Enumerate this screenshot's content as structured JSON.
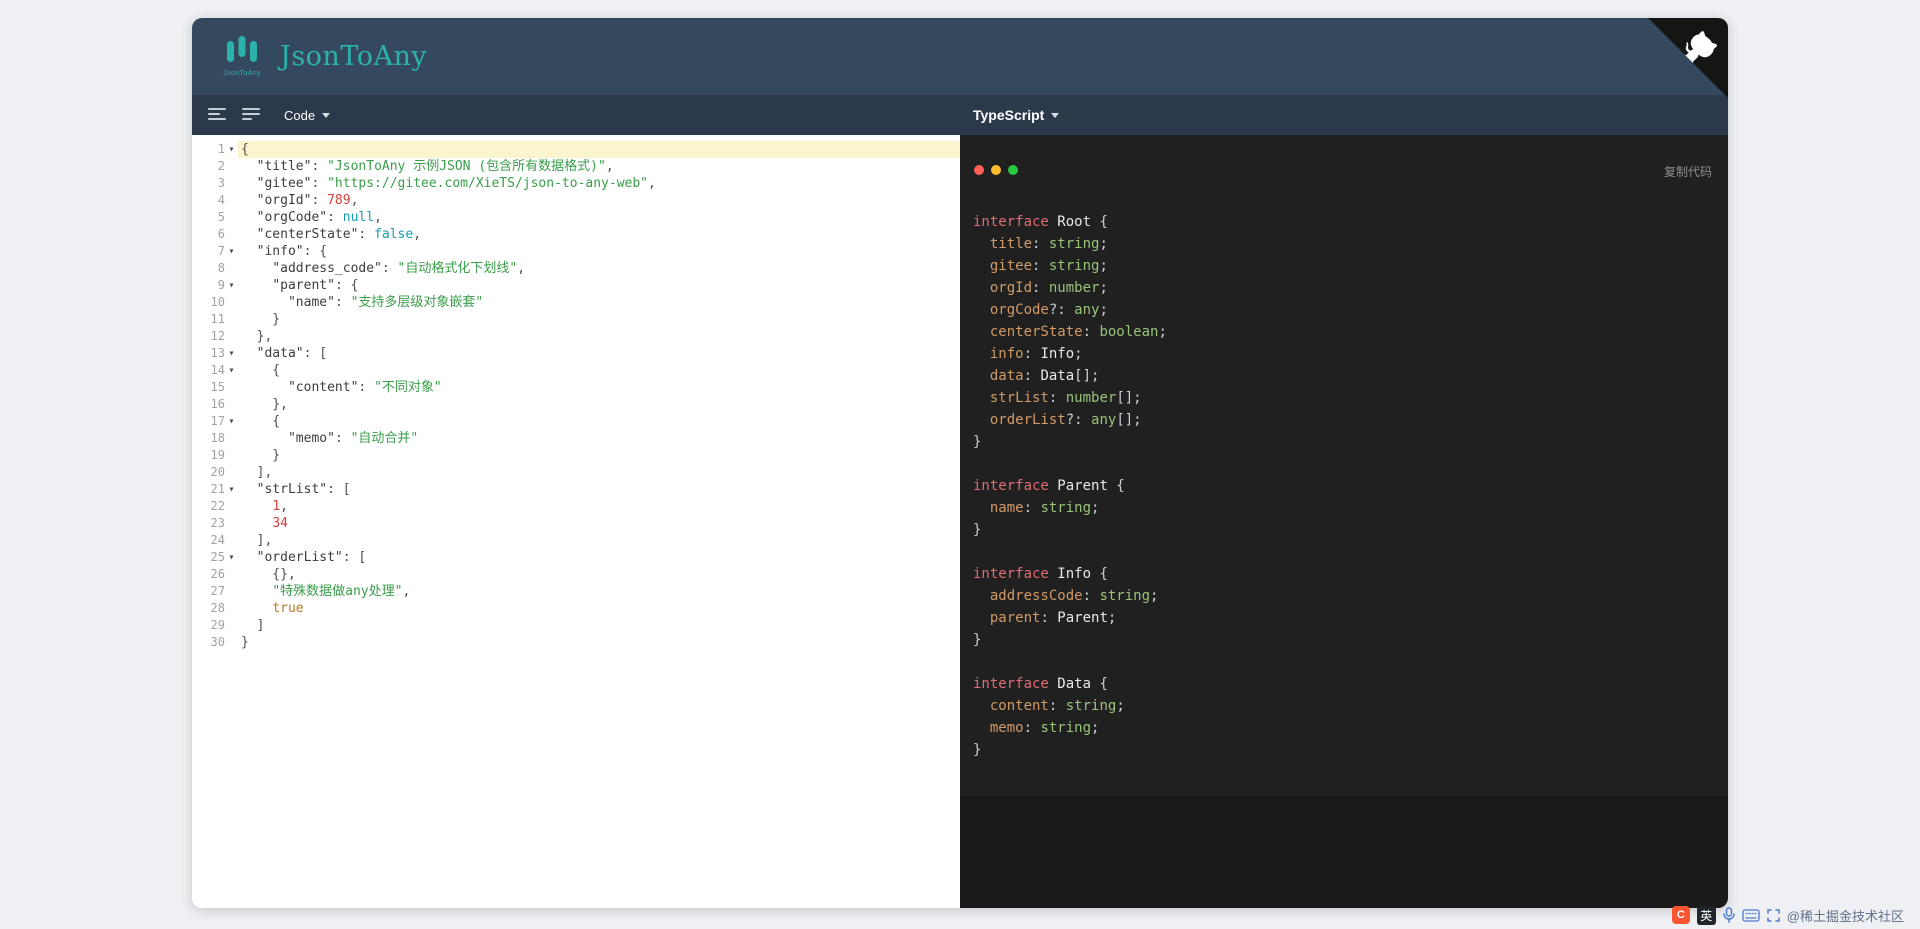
{
  "app": {
    "title": "JsonToAny",
    "logo_caption": "JsonToAny"
  },
  "toolbar": {
    "source_dropdown_label": "Code",
    "output_dropdown_label": "TypeScript"
  },
  "output_panel": {
    "copy_button_label": "复制代码"
  },
  "tray": {
    "ime_label": "英",
    "csdn_label": "C",
    "watermark": "@稀土掘金技术社区"
  },
  "colors": {
    "accent_teal": "#2bb3a9",
    "header_bg": "#35495e",
    "toolbar_bg": "#2b394b",
    "editor_active_line": "#fbf5cd",
    "panel_bg": "#1a1a1a",
    "code_surface_bg": "#202020",
    "dot_red": "#ff5f56",
    "dot_yellow": "#ffbd2e",
    "dot_green": "#27c93f",
    "json_key": "#3d3d3d",
    "json_string": "#3a9e4b",
    "json_number": "#d1403a",
    "json_null_false": "#149cab",
    "json_true": "#bd7722",
    "ts_keyword": "#e06c75",
    "ts_type": "#e9e9e9",
    "ts_property": "#d19a66",
    "ts_primitive": "#98c379"
  },
  "editor": {
    "lines": [
      {
        "n": 1,
        "fold": true,
        "active": true,
        "t": [
          [
            "p",
            "{"
          ]
        ]
      },
      {
        "n": 2,
        "fold": false,
        "active": false,
        "t": [
          [
            "p",
            "  "
          ],
          [
            "k",
            "\"title\""
          ],
          [
            "p",
            ": "
          ],
          [
            "s",
            "\"JsonToAny 示例JSON (包含所有数据格式)\""
          ],
          [
            "p",
            ","
          ]
        ]
      },
      {
        "n": 3,
        "fold": false,
        "active": false,
        "t": [
          [
            "p",
            "  "
          ],
          [
            "k",
            "\"gitee\""
          ],
          [
            "p",
            ": "
          ],
          [
            "s",
            "\"https://gitee.com/XieTS/json-to-any-web\""
          ],
          [
            "p",
            ","
          ]
        ]
      },
      {
        "n": 4,
        "fold": false,
        "active": false,
        "t": [
          [
            "p",
            "  "
          ],
          [
            "k",
            "\"orgId\""
          ],
          [
            "p",
            ": "
          ],
          [
            "n",
            "789"
          ],
          [
            "p",
            ","
          ]
        ]
      },
      {
        "n": 5,
        "fold": false,
        "active": false,
        "t": [
          [
            "p",
            "  "
          ],
          [
            "k",
            "\"orgCode\""
          ],
          [
            "p",
            ": "
          ],
          [
            "a",
            "null"
          ],
          [
            "p",
            ","
          ]
        ]
      },
      {
        "n": 6,
        "fold": false,
        "active": false,
        "t": [
          [
            "p",
            "  "
          ],
          [
            "k",
            "\"centerState\""
          ],
          [
            "p",
            ": "
          ],
          [
            "a",
            "false"
          ],
          [
            "p",
            ","
          ]
        ]
      },
      {
        "n": 7,
        "fold": true,
        "active": false,
        "t": [
          [
            "p",
            "  "
          ],
          [
            "k",
            "\"info\""
          ],
          [
            "p",
            ": {"
          ]
        ]
      },
      {
        "n": 8,
        "fold": false,
        "active": false,
        "t": [
          [
            "p",
            "    "
          ],
          [
            "k",
            "\"address_code\""
          ],
          [
            "p",
            ": "
          ],
          [
            "s",
            "\"自动格式化下划线\""
          ],
          [
            "p",
            ","
          ]
        ]
      },
      {
        "n": 9,
        "fold": true,
        "active": false,
        "t": [
          [
            "p",
            "    "
          ],
          [
            "k",
            "\"parent\""
          ],
          [
            "p",
            ": {"
          ]
        ]
      },
      {
        "n": 10,
        "fold": false,
        "active": false,
        "t": [
          [
            "p",
            "      "
          ],
          [
            "k",
            "\"name\""
          ],
          [
            "p",
            ": "
          ],
          [
            "s",
            "\"支持多层级对象嵌套\""
          ]
        ]
      },
      {
        "n": 11,
        "fold": false,
        "active": false,
        "t": [
          [
            "p",
            "    }"
          ]
        ]
      },
      {
        "n": 12,
        "fold": false,
        "active": false,
        "t": [
          [
            "p",
            "  },"
          ]
        ]
      },
      {
        "n": 13,
        "fold": true,
        "active": false,
        "t": [
          [
            "p",
            "  "
          ],
          [
            "k",
            "\"data\""
          ],
          [
            "p",
            ": ["
          ]
        ]
      },
      {
        "n": 14,
        "fold": true,
        "active": false,
        "t": [
          [
            "p",
            "    {"
          ]
        ]
      },
      {
        "n": 15,
        "fold": false,
        "active": false,
        "t": [
          [
            "p",
            "      "
          ],
          [
            "k",
            "\"content\""
          ],
          [
            "p",
            ": "
          ],
          [
            "s",
            "\"不同对象\""
          ]
        ]
      },
      {
        "n": 16,
        "fold": false,
        "active": false,
        "t": [
          [
            "p",
            "    },"
          ]
        ]
      },
      {
        "n": 17,
        "fold": true,
        "active": false,
        "t": [
          [
            "p",
            "    {"
          ]
        ]
      },
      {
        "n": 18,
        "fold": false,
        "active": false,
        "t": [
          [
            "p",
            "      "
          ],
          [
            "k",
            "\"memo\""
          ],
          [
            "p",
            ": "
          ],
          [
            "s",
            "\"自动合并\""
          ]
        ]
      },
      {
        "n": 19,
        "fold": false,
        "active": false,
        "t": [
          [
            "p",
            "    }"
          ]
        ]
      },
      {
        "n": 20,
        "fold": false,
        "active": false,
        "t": [
          [
            "p",
            "  ],"
          ]
        ]
      },
      {
        "n": 21,
        "fold": true,
        "active": false,
        "t": [
          [
            "p",
            "  "
          ],
          [
            "k",
            "\"strList\""
          ],
          [
            "p",
            ": ["
          ]
        ]
      },
      {
        "n": 22,
        "fold": false,
        "active": false,
        "t": [
          [
            "p",
            "    "
          ],
          [
            "n",
            "1"
          ],
          [
            "p",
            ","
          ]
        ]
      },
      {
        "n": 23,
        "fold": false,
        "active": false,
        "t": [
          [
            "p",
            "    "
          ],
          [
            "n",
            "34"
          ]
        ]
      },
      {
        "n": 24,
        "fold": false,
        "active": false,
        "t": [
          [
            "p",
            "  ],"
          ]
        ]
      },
      {
        "n": 25,
        "fold": true,
        "active": false,
        "t": [
          [
            "p",
            "  "
          ],
          [
            "k",
            "\"orderList\""
          ],
          [
            "p",
            ": ["
          ]
        ]
      },
      {
        "n": 26,
        "fold": false,
        "active": false,
        "t": [
          [
            "p",
            "    {},"
          ]
        ]
      },
      {
        "n": 27,
        "fold": false,
        "active": false,
        "t": [
          [
            "p",
            "    "
          ],
          [
            "s",
            "\"特殊数据做any处理\""
          ],
          [
            "p",
            ","
          ]
        ]
      },
      {
        "n": 28,
        "fold": false,
        "active": false,
        "t": [
          [
            "p",
            "    "
          ],
          [
            "b",
            "true"
          ]
        ]
      },
      {
        "n": 29,
        "fold": false,
        "active": false,
        "t": [
          [
            "p",
            "  ]"
          ]
        ]
      },
      {
        "n": 30,
        "fold": false,
        "active": false,
        "t": [
          [
            "p",
            "}"
          ]
        ]
      }
    ]
  },
  "output": {
    "lines": [
      [
        [
          "kw",
          "interface"
        ],
        [
          "pu",
          " "
        ],
        [
          "ty",
          "Root"
        ],
        [
          "pu",
          " {"
        ]
      ],
      [
        [
          "pu",
          "  "
        ],
        [
          "pr",
          "title"
        ],
        [
          "pu",
          ": "
        ],
        [
          "pm",
          "string"
        ],
        [
          "pu",
          ";"
        ]
      ],
      [
        [
          "pu",
          "  "
        ],
        [
          "pr",
          "gitee"
        ],
        [
          "pu",
          ": "
        ],
        [
          "pm",
          "string"
        ],
        [
          "pu",
          ";"
        ]
      ],
      [
        [
          "pu",
          "  "
        ],
        [
          "pr",
          "orgId"
        ],
        [
          "pu",
          ": "
        ],
        [
          "pm",
          "number"
        ],
        [
          "pu",
          ";"
        ]
      ],
      [
        [
          "pu",
          "  "
        ],
        [
          "pr",
          "orgCode"
        ],
        [
          "pu",
          "?: "
        ],
        [
          "pm",
          "any"
        ],
        [
          "pu",
          ";"
        ]
      ],
      [
        [
          "pu",
          "  "
        ],
        [
          "pr",
          "centerState"
        ],
        [
          "pu",
          ": "
        ],
        [
          "pm",
          "boolean"
        ],
        [
          "pu",
          ";"
        ]
      ],
      [
        [
          "pu",
          "  "
        ],
        [
          "pr",
          "info"
        ],
        [
          "pu",
          ": "
        ],
        [
          "ty",
          "Info"
        ],
        [
          "pu",
          ";"
        ]
      ],
      [
        [
          "pu",
          "  "
        ],
        [
          "pr",
          "data"
        ],
        [
          "pu",
          ": "
        ],
        [
          "ty",
          "Data"
        ],
        [
          "pu",
          "[];"
        ]
      ],
      [
        [
          "pu",
          "  "
        ],
        [
          "pr",
          "strList"
        ],
        [
          "pu",
          ": "
        ],
        [
          "pm",
          "number"
        ],
        [
          "pu",
          "[];"
        ]
      ],
      [
        [
          "pu",
          "  "
        ],
        [
          "pr",
          "orderList"
        ],
        [
          "pu",
          "?: "
        ],
        [
          "pm",
          "any"
        ],
        [
          "pu",
          "[];"
        ]
      ],
      [
        [
          "pu",
          "}"
        ]
      ],
      [],
      [
        [
          "kw",
          "interface"
        ],
        [
          "pu",
          " "
        ],
        [
          "ty",
          "Parent"
        ],
        [
          "pu",
          " {"
        ]
      ],
      [
        [
          "pu",
          "  "
        ],
        [
          "pr",
          "name"
        ],
        [
          "pu",
          ": "
        ],
        [
          "pm",
          "string"
        ],
        [
          "pu",
          ";"
        ]
      ],
      [
        [
          "pu",
          "}"
        ]
      ],
      [],
      [
        [
          "kw",
          "interface"
        ],
        [
          "pu",
          " "
        ],
        [
          "ty",
          "Info"
        ],
        [
          "pu",
          " {"
        ]
      ],
      [
        [
          "pu",
          "  "
        ],
        [
          "pr",
          "addressCode"
        ],
        [
          "pu",
          ": "
        ],
        [
          "pm",
          "string"
        ],
        [
          "pu",
          ";"
        ]
      ],
      [
        [
          "pu",
          "  "
        ],
        [
          "pr",
          "parent"
        ],
        [
          "pu",
          ": "
        ],
        [
          "ty",
          "Parent"
        ],
        [
          "pu",
          ";"
        ]
      ],
      [
        [
          "pu",
          "}"
        ]
      ],
      [],
      [
        [
          "kw",
          "interface"
        ],
        [
          "pu",
          " "
        ],
        [
          "ty",
          "Data"
        ],
        [
          "pu",
          " {"
        ]
      ],
      [
        [
          "pu",
          "  "
        ],
        [
          "pr",
          "content"
        ],
        [
          "pu",
          ": "
        ],
        [
          "pm",
          "string"
        ],
        [
          "pu",
          ";"
        ]
      ],
      [
        [
          "pu",
          "  "
        ],
        [
          "pr",
          "memo"
        ],
        [
          "pu",
          ": "
        ],
        [
          "pm",
          "string"
        ],
        [
          "pu",
          ";"
        ]
      ],
      [
        [
          "pu",
          "}"
        ]
      ]
    ]
  }
}
